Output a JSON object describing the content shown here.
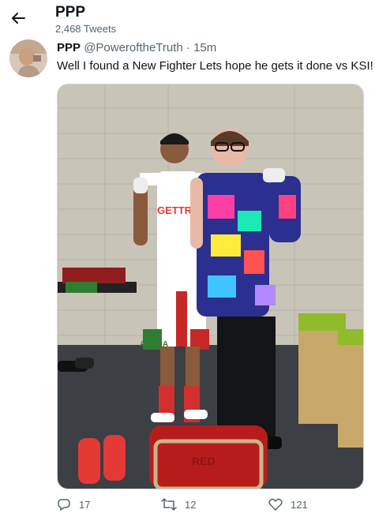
{
  "header": {
    "title": "PPP",
    "tweet_count": "2,468 Tweets"
  },
  "tweet": {
    "display_name": "PPP",
    "handle": "@PoweroftheTruth",
    "separator": "·",
    "time": "15m",
    "text": "Well I found a New Fighter Lets hope he gets it done vs KSI!",
    "photo_texts": {
      "shirt": "GETTR",
      "shorts": "ACARA",
      "chair": "RED"
    },
    "stats": {
      "replies": "17",
      "retweets": "12",
      "likes": "121"
    }
  },
  "icons": {
    "back": "back-arrow-icon",
    "reply": "reply-icon",
    "retweet": "retweet-icon",
    "like": "heart-icon"
  },
  "colors": {
    "text": "#0f1419",
    "muted": "#536471",
    "border": "#cfd9de"
  }
}
